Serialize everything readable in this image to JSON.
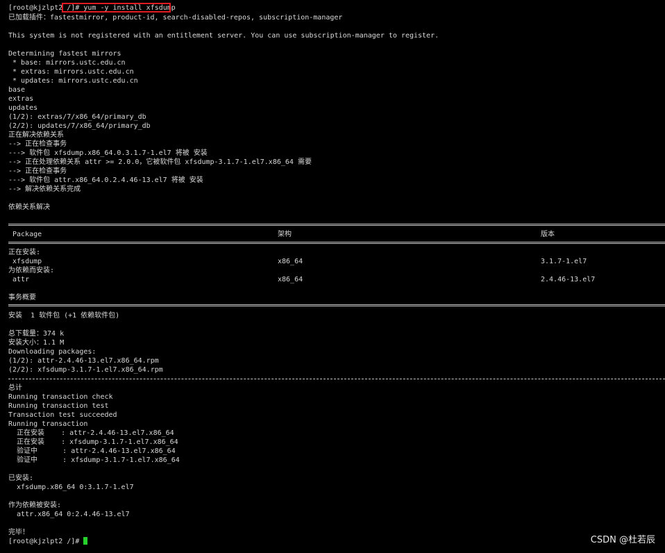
{
  "terminal": {
    "prompt_line": "[root@kjzlpt2 /]# yum -y install xfsdump",
    "lines": {
      "l1": "已加载插件：fastestmirror, product-id, search-disabled-repos, subscription-manager",
      "l2": "This system is not registered with an entitlement server. You can use subscription-manager to register.",
      "l3": "Determining fastest mirrors",
      "l4": " * base: mirrors.ustc.edu.cn",
      "l5": " * extras: mirrors.ustc.edu.cn",
      "l6": " * updates: mirrors.ustc.edu.cn",
      "l7": "base",
      "l8": "extras",
      "l9": "updates",
      "l10": "(1/2): extras/7/x86_64/primary_db",
      "l11": "(2/2): updates/7/x86_64/primary_db",
      "l12": "正在解决依赖关系",
      "l13": "--> 正在检查事务",
      "l14": "---> 软件包 xfsdump.x86_64.0.3.1.7-1.el7 将被 安装",
      "l15": "--> 正在处理依赖关系 attr >= 2.0.0，它被软件包 xfsdump-3.1.7-1.el7.x86_64 需要",
      "l16": "--> 正在检查事务",
      "l17": "---> 软件包 attr.x86_64.0.2.4.46-13.el7 将被 安装",
      "l18": "--> 解决依赖关系完成",
      "l19": "依赖关系解决"
    },
    "table": {
      "headers": [
        "Package",
        "架构",
        "版本"
      ],
      "installing_label": "正在安装:",
      "dep_label": "为依赖而安装:",
      "rows": [
        {
          "name": " xfsdump",
          "arch": "x86_64",
          "version": "3.1.7-1.el7"
        },
        {
          "name": " attr",
          "arch": "x86_64",
          "version": "2.4.46-13.el7"
        }
      ]
    },
    "summary": {
      "title": "事务概要",
      "install_line": "安装  1 软件包 (+1 依赖软件包)",
      "download_size": "总下载量：374 k",
      "installed_size": "安装大小：1.1 M",
      "downloading": "Downloading packages:",
      "pkg1": "(1/2): attr-2.4.46-13.el7.x86_64.rpm",
      "pkg2": "(2/2): xfsdump-3.1.7-1.el7.x86_64.rpm"
    },
    "transaction": {
      "total": "总计",
      "check": "Running transaction check",
      "test": "Running transaction test",
      "test_ok": "Transaction test succeeded",
      "running": "Running transaction",
      "steps": [
        "  正在安装    : attr-2.4.46-13.el7.x86_64",
        "  正在安装    : xfsdump-3.1.7-1.el7.x86_64",
        "  验证中      : attr-2.4.46-13.el7.x86_64",
        "  验证中      : xfsdump-3.1.7-1.el7.x86_64"
      ]
    },
    "result": {
      "installed_label": "已安装:",
      "installed_pkg": "  xfsdump.x86_64 0:3.1.7-1.el7",
      "dep_installed_label": "作为依赖被安装:",
      "dep_installed_pkg": "  attr.x86_64 0:2.4.46-13.el7",
      "done": "完毕！",
      "final_prompt": "[root@kjzlpt2 /]# "
    }
  },
  "watermark": "CSDN @杜若辰",
  "colors": {
    "background": "#000000",
    "text": "#d8d8d8",
    "highlight_box": "#e01b24",
    "cursor": "#25d12a"
  }
}
